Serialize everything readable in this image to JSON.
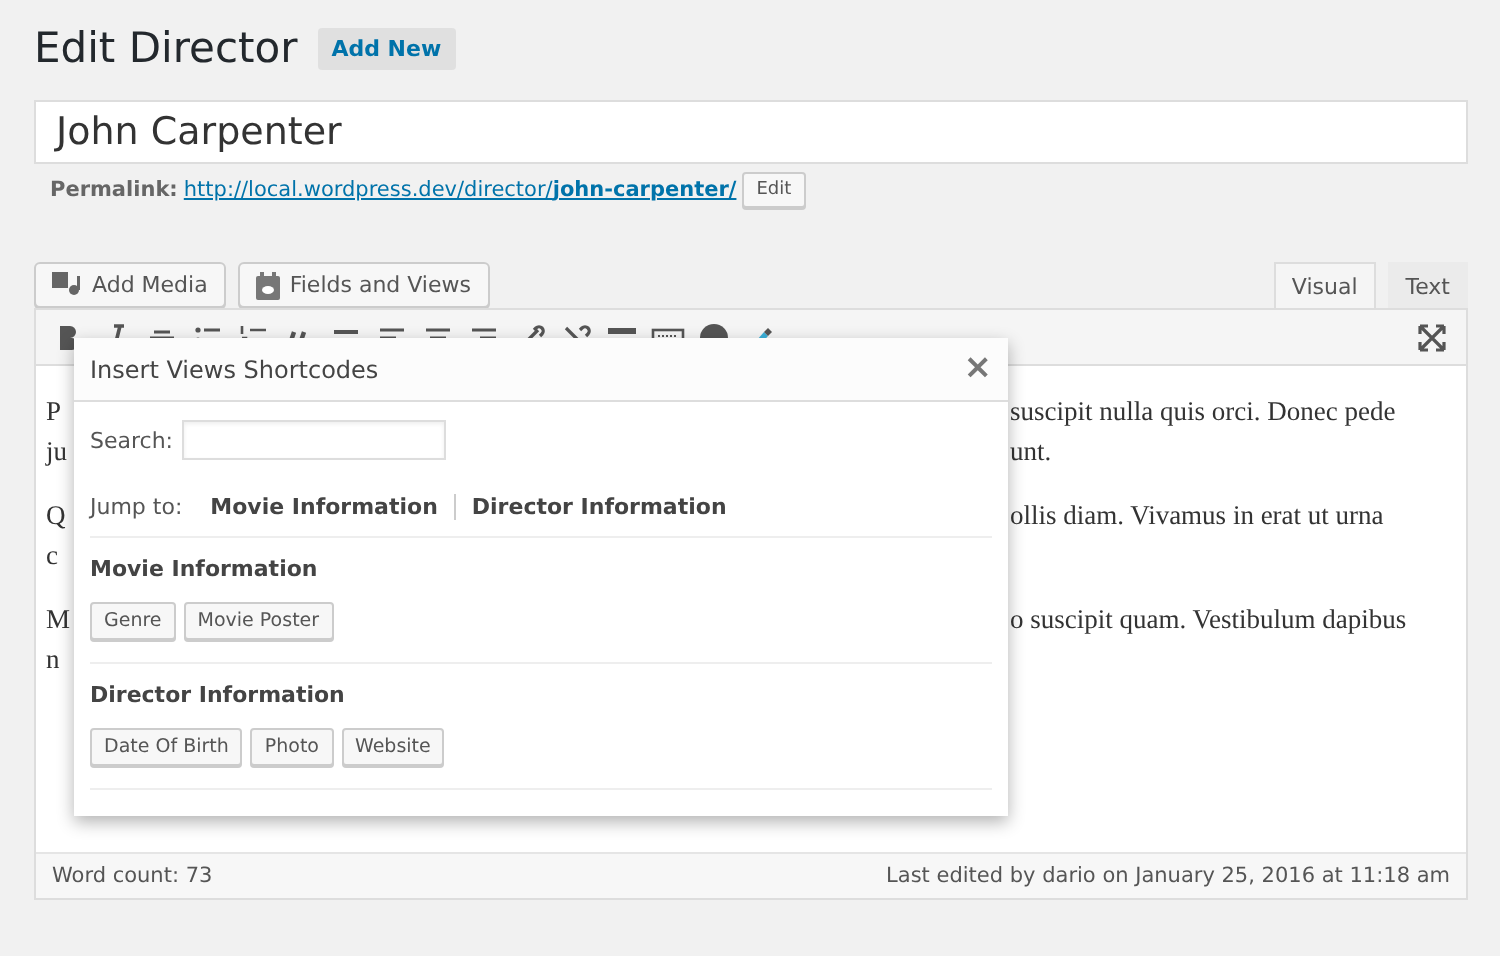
{
  "page_title": "Edit Director",
  "add_new": "Add New",
  "title_field": {
    "value": "John Carpenter"
  },
  "permalink": {
    "label": "Permalink:",
    "url_base": "http://local.wordpress.dev/director/",
    "slug": "john-carpenter/",
    "edit": "Edit"
  },
  "media_buttons": [
    {
      "label": "Add Media"
    },
    {
      "label": "Fields and Views"
    }
  ],
  "editor_tabs": [
    {
      "label": "Visual",
      "selected": true
    },
    {
      "label": "Text",
      "selected": false
    }
  ],
  "editor_paragraphs": [
    {
      "lines": [
        {
          "left": "P",
          "right": "suscipit nulla quis orci. Donec pede"
        },
        {
          "left": "ju",
          "right": "unt."
        }
      ]
    },
    {
      "lines": [
        {
          "left": "Q",
          "right": "ollis diam. Vivamus in erat ut urna"
        },
        {
          "left": "c"
        }
      ]
    },
    {
      "lines": [
        {
          "left": "M",
          "right": "o suscipit quam. Vestibulum dapibus"
        },
        {
          "left": "n"
        }
      ]
    }
  ],
  "status_bar": {
    "word_count": "Word count: 73",
    "last_edited": "Last edited by dario on January 25, 2016 at 11:18 am"
  },
  "dialog": {
    "title": "Insert Views Shortcodes",
    "close": "×",
    "search_label": "Search:",
    "jump_label": "Jump to:",
    "jump_links": [
      "Movie Information",
      "Director Information"
    ],
    "groups": [
      {
        "title": "Movie Information",
        "buttons": [
          "Genre",
          "Movie Poster"
        ]
      },
      {
        "title": "Director Information",
        "buttons": [
          "Date Of Birth",
          "Photo",
          "Website"
        ]
      }
    ]
  }
}
